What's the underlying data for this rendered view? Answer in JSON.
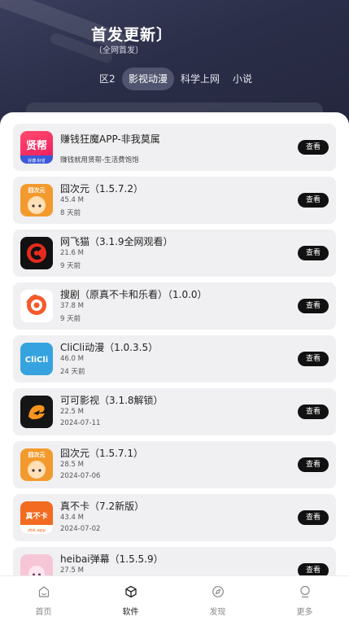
{
  "header": {
    "title": "首发更新〕",
    "subtitle": "〔全网首发〕"
  },
  "tabs": [
    {
      "label": "区2"
    },
    {
      "label": "影视动漫",
      "active": true
    },
    {
      "label": "科学上网"
    },
    {
      "label": "小说"
    }
  ],
  "apps": [
    {
      "name": "赚钱狂魔APP-非我莫属",
      "size": "",
      "date": "",
      "desc": "赚钱就用贤帮-生活费饱饱",
      "button": "查看",
      "icon": "xianbang-icon",
      "icon_text": "贤帮",
      "icon_sub": "好康·好省"
    },
    {
      "name": "囧次元（1.5.7.2）",
      "size": "45.4 M",
      "date": "8 天前",
      "button": "查看",
      "icon": "jiongciyuan-icon",
      "icon_text": "囧次元"
    },
    {
      "name": "网飞猫（3.1.9全网观看）",
      "size": "21.6 M",
      "date": "9 天前",
      "button": "查看",
      "icon": "wangfeimao-icon",
      "icon_text": "C"
    },
    {
      "name": "搜剧（原真不卡和乐看）（1.0.0）",
      "size": "37.8 M",
      "date": "9 天前",
      "button": "查看",
      "icon": "souju-icon",
      "icon_text": ""
    },
    {
      "name": "CliCli动漫（1.0.3.5）",
      "size": "46.0 M",
      "date": "24 天前",
      "button": "查看",
      "icon": "clicli-icon",
      "icon_text": "CliCli"
    },
    {
      "name": "可可影视（3.1.8解锁）",
      "size": "22.5 M",
      "date": "2024-07-11",
      "button": "查看",
      "icon": "keke-icon",
      "icon_text": ""
    },
    {
      "name": "囧次元（1.5.7.1）",
      "size": "28.5 M",
      "date": "2024-07-06",
      "button": "查看",
      "icon": "jiongciyuan-icon",
      "icon_text": "囧次元"
    },
    {
      "name": "真不卡（7.2新版）",
      "size": "43.4 M",
      "date": "2024-07-02",
      "button": "查看",
      "icon": "zhenbuka-icon",
      "icon_text": "真不卡",
      "icon_sub": "zbk.app"
    },
    {
      "name": "heibai弹幕（1.5.5.9）",
      "size": "27.5 M",
      "date": "",
      "button": "查看",
      "icon": "heibai-icon",
      "icon_text": ""
    }
  ],
  "nav": [
    {
      "label": "首页",
      "icon": "home-icon"
    },
    {
      "label": "软件",
      "icon": "cube-icon",
      "active": true
    },
    {
      "label": "发现",
      "icon": "compass-icon"
    },
    {
      "label": "更多",
      "icon": "user-icon"
    }
  ]
}
